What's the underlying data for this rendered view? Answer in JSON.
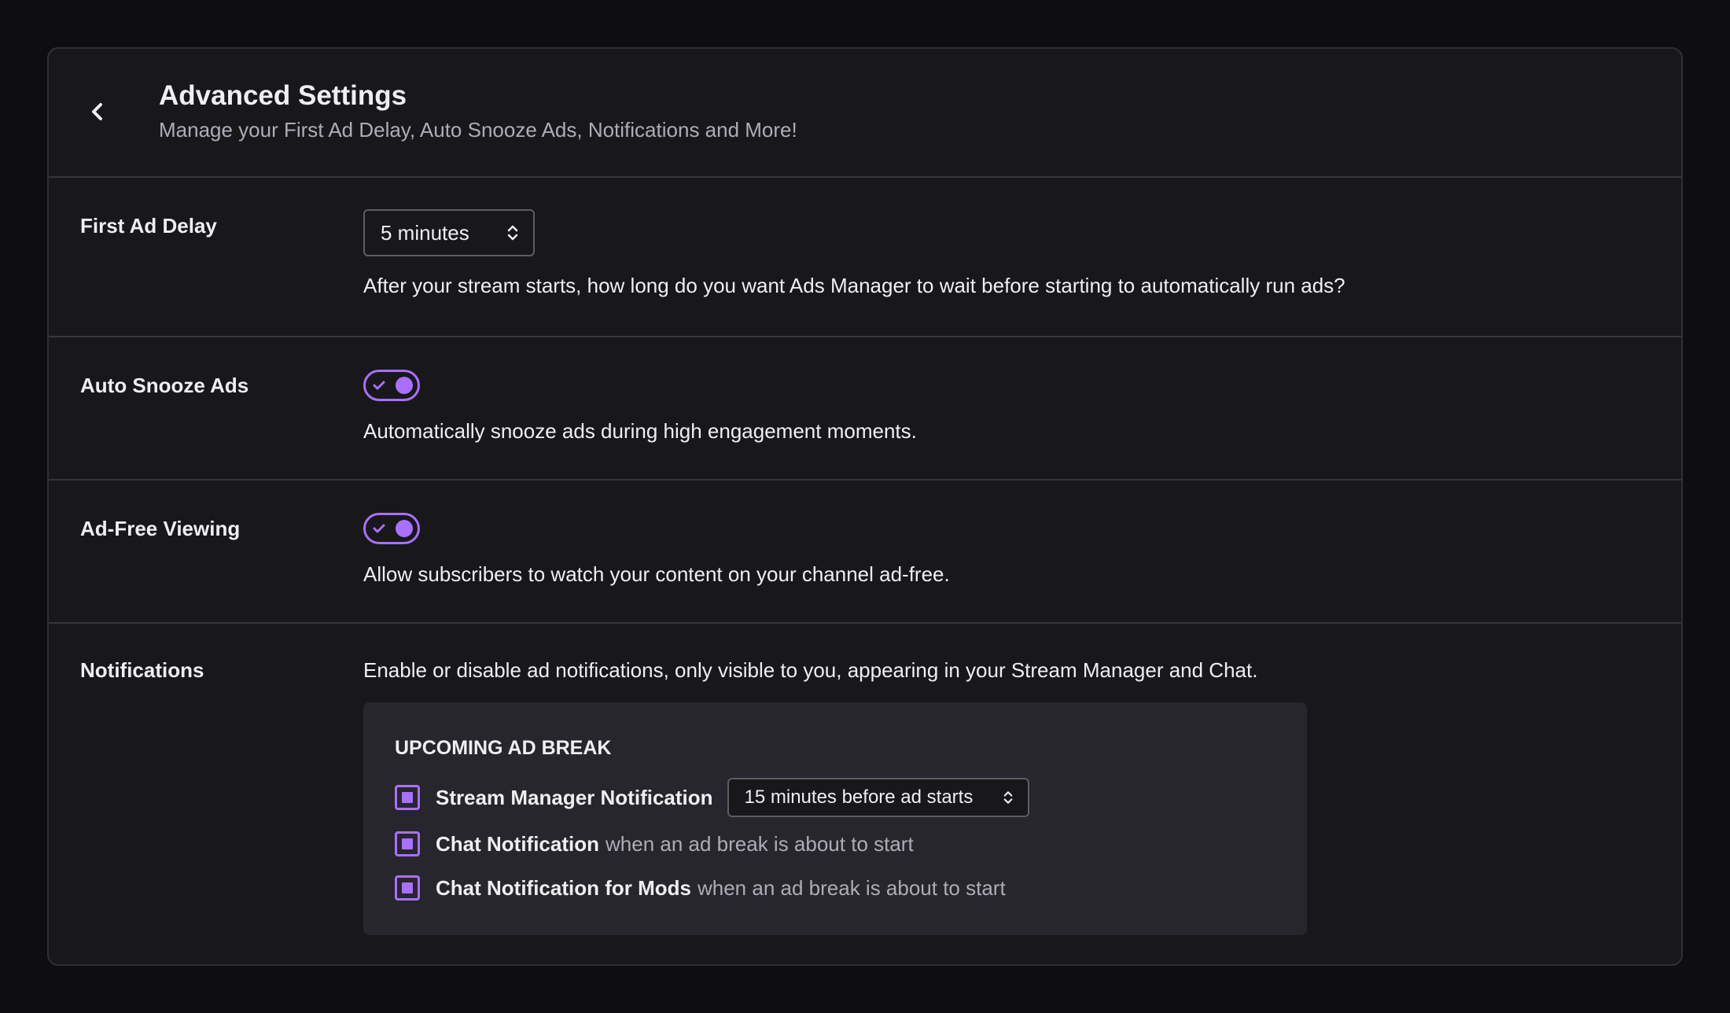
{
  "header": {
    "title": "Advanced Settings",
    "subtitle": "Manage your First Ad Delay, Auto Snooze Ads, Notifications and More!"
  },
  "first_ad_delay": {
    "label": "First Ad Delay",
    "selected": "5 minutes",
    "description": "After your stream starts, how long do you want Ads Manager to wait before starting to automatically run ads?"
  },
  "auto_snooze": {
    "label": "Auto Snooze Ads",
    "enabled": true,
    "description": "Automatically snooze ads during high engagement moments."
  },
  "ad_free": {
    "label": "Ad-Free Viewing",
    "enabled": true,
    "description": "Allow subscribers to watch your content on your channel ad-free."
  },
  "notifications": {
    "label": "Notifications",
    "description": "Enable or disable ad notifications, only visible to you, appearing in your Stream Manager and Chat.",
    "section_heading": "UPCOMING AD BREAK",
    "items": [
      {
        "strong": "Stream Manager Notification",
        "weak": "",
        "checked": true,
        "select": "15 minutes before ad starts"
      },
      {
        "strong": "Chat Notification",
        "weak": "when an ad break is about to start",
        "checked": true
      },
      {
        "strong": "Chat Notification for Mods",
        "weak": "when an ad break is about to start",
        "checked": true
      }
    ]
  },
  "colors": {
    "accent": "#a970ff",
    "panel_bg": "#18181b",
    "page_bg": "#0e0e10",
    "box_bg": "#26262c"
  }
}
